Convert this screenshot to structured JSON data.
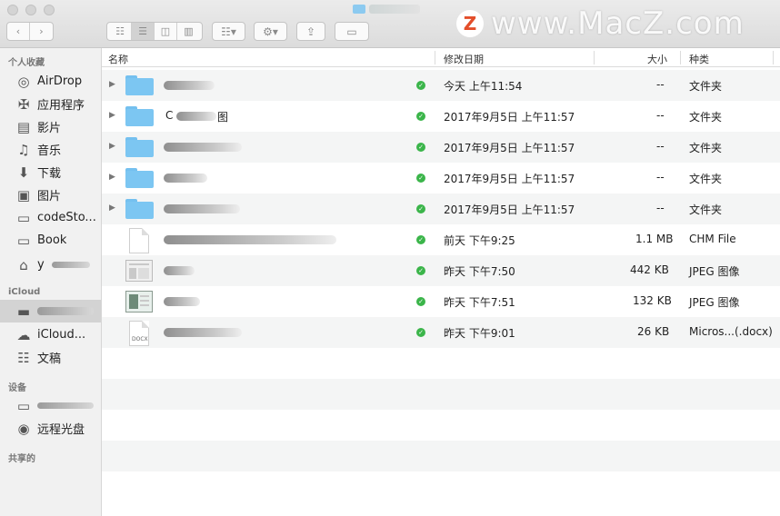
{
  "window": {
    "title_icon": "folder-icon"
  },
  "watermark": {
    "logo": "Z",
    "text": "www.MacZ.com"
  },
  "toolbar": {
    "back_icon": "chevron-left-icon",
    "forward_icon": "chevron-right-icon",
    "view_modes": [
      "icon-view-icon",
      "list-view-icon",
      "column-view-icon",
      "coverflow-view-icon"
    ],
    "active_view": "list-view-icon",
    "arrange_icon": "grid-arrange-icon",
    "action_icon": "gear-icon",
    "share_icon": "share-icon",
    "tag_icon": "tag-icon"
  },
  "sidebar": {
    "favorites_header": "个人收藏",
    "favorites": [
      {
        "label": "AirDrop",
        "icon": "airdrop-icon"
      },
      {
        "label": "应用程序",
        "icon": "applications-icon"
      },
      {
        "label": "影片",
        "icon": "film-icon"
      },
      {
        "label": "音乐",
        "icon": "music-icon"
      },
      {
        "label": "下载",
        "icon": "download-icon"
      },
      {
        "label": "图片",
        "icon": "camera-icon"
      },
      {
        "label": "codeSto...",
        "icon": "folder-icon"
      },
      {
        "label": "Book",
        "icon": "folder-icon"
      },
      {
        "label": "y",
        "icon": "home-icon"
      }
    ],
    "icloud_header": "iCloud",
    "icloud": [
      {
        "label": "",
        "icon": "folder-icon"
      },
      {
        "label": "iCloud...",
        "icon": "cloud-icon"
      },
      {
        "label": "文稿",
        "icon": "document-icon"
      }
    ],
    "devices_header": "设备",
    "devices": [
      {
        "label": "",
        "icon": "laptop-icon"
      },
      {
        "label": "远程光盘",
        "icon": "disc-icon"
      }
    ],
    "shared_header": "共享的"
  },
  "columns": {
    "name": "名称",
    "date": "修改日期",
    "size": "大小",
    "kind": "种类"
  },
  "files": [
    {
      "type": "folder",
      "name": "",
      "date": "今天 上午11:54",
      "size": "--",
      "kind": "文件夹"
    },
    {
      "type": "folder",
      "name": "C",
      "name_suffix": "图",
      "date": "2017年9月5日 上午11:57",
      "size": "--",
      "kind": "文件夹"
    },
    {
      "type": "folder",
      "name": "",
      "date": "2017年9月5日 上午11:57",
      "size": "--",
      "kind": "文件夹"
    },
    {
      "type": "folder",
      "name": "",
      "date": "2017年9月5日 上午11:57",
      "size": "--",
      "kind": "文件夹"
    },
    {
      "type": "folder",
      "name": "",
      "date": "2017年9月5日 上午11:57",
      "size": "--",
      "kind": "文件夹"
    },
    {
      "type": "doc",
      "name": "",
      "date": "前天 下午9:25",
      "size": "1.1 MB",
      "kind": "CHM  File"
    },
    {
      "type": "image",
      "name": "",
      "date": "昨天 下午7:50",
      "size": "442 KB",
      "kind": "JPEG 图像"
    },
    {
      "type": "image2",
      "name": "",
      "date": "昨天 下午7:51",
      "size": "132 KB",
      "kind": "JPEG 图像"
    },
    {
      "type": "docx",
      "name": "",
      "date": "昨天 下午9:01",
      "size": "26 KB",
      "kind": "Micros...(.docx)"
    }
  ],
  "docx_label": "DOCX",
  "status_icon": "synced-check-icon"
}
